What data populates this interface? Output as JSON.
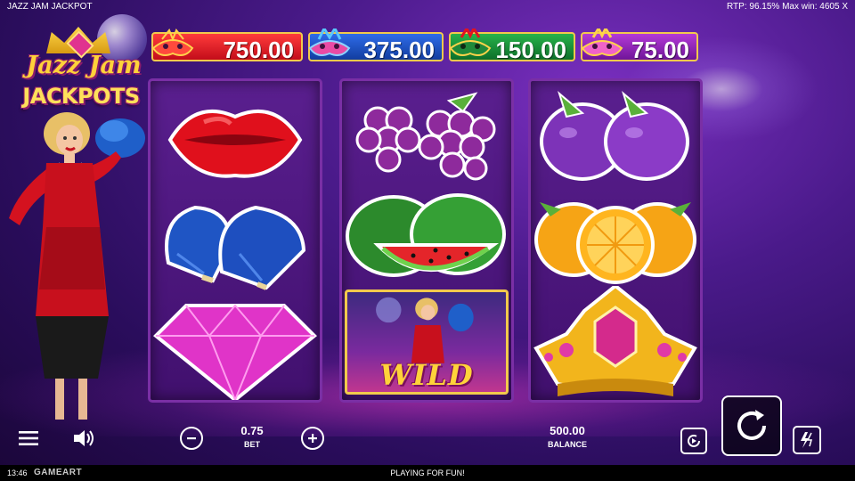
{
  "header": {
    "game_name": "JAZZ JAM JACKPOT",
    "rtp_text": "RTP: 96.15% Max win: 4605 X"
  },
  "logo": {
    "line1": "Jazz Jam",
    "line2": "JACKPOTS"
  },
  "jackpots": [
    {
      "amount": "750.00",
      "color": "#e3121f"
    },
    {
      "amount": "375.00",
      "color": "#1f57d6"
    },
    {
      "amount": "150.00",
      "color": "#1c9a3c"
    },
    {
      "amount": "75.00",
      "color": "#9b2ac4"
    }
  ],
  "reels": [
    {
      "symbols": [
        "lips",
        "feather-fans",
        "pink-diamond"
      ]
    },
    {
      "symbols": [
        "grapes",
        "watermelon",
        "wild"
      ]
    },
    {
      "symbols": [
        "plums",
        "oranges",
        "gold-crown"
      ]
    }
  ],
  "wild": {
    "text": "WILD"
  },
  "controls": {
    "bet_value": "0.75",
    "bet_label": "BET",
    "balance_value": "500.00",
    "balance_label": "BALANCE"
  },
  "status": {
    "time": "13:46",
    "brand": "GAMEART",
    "mode": "PLAYING FOR FUN!"
  }
}
